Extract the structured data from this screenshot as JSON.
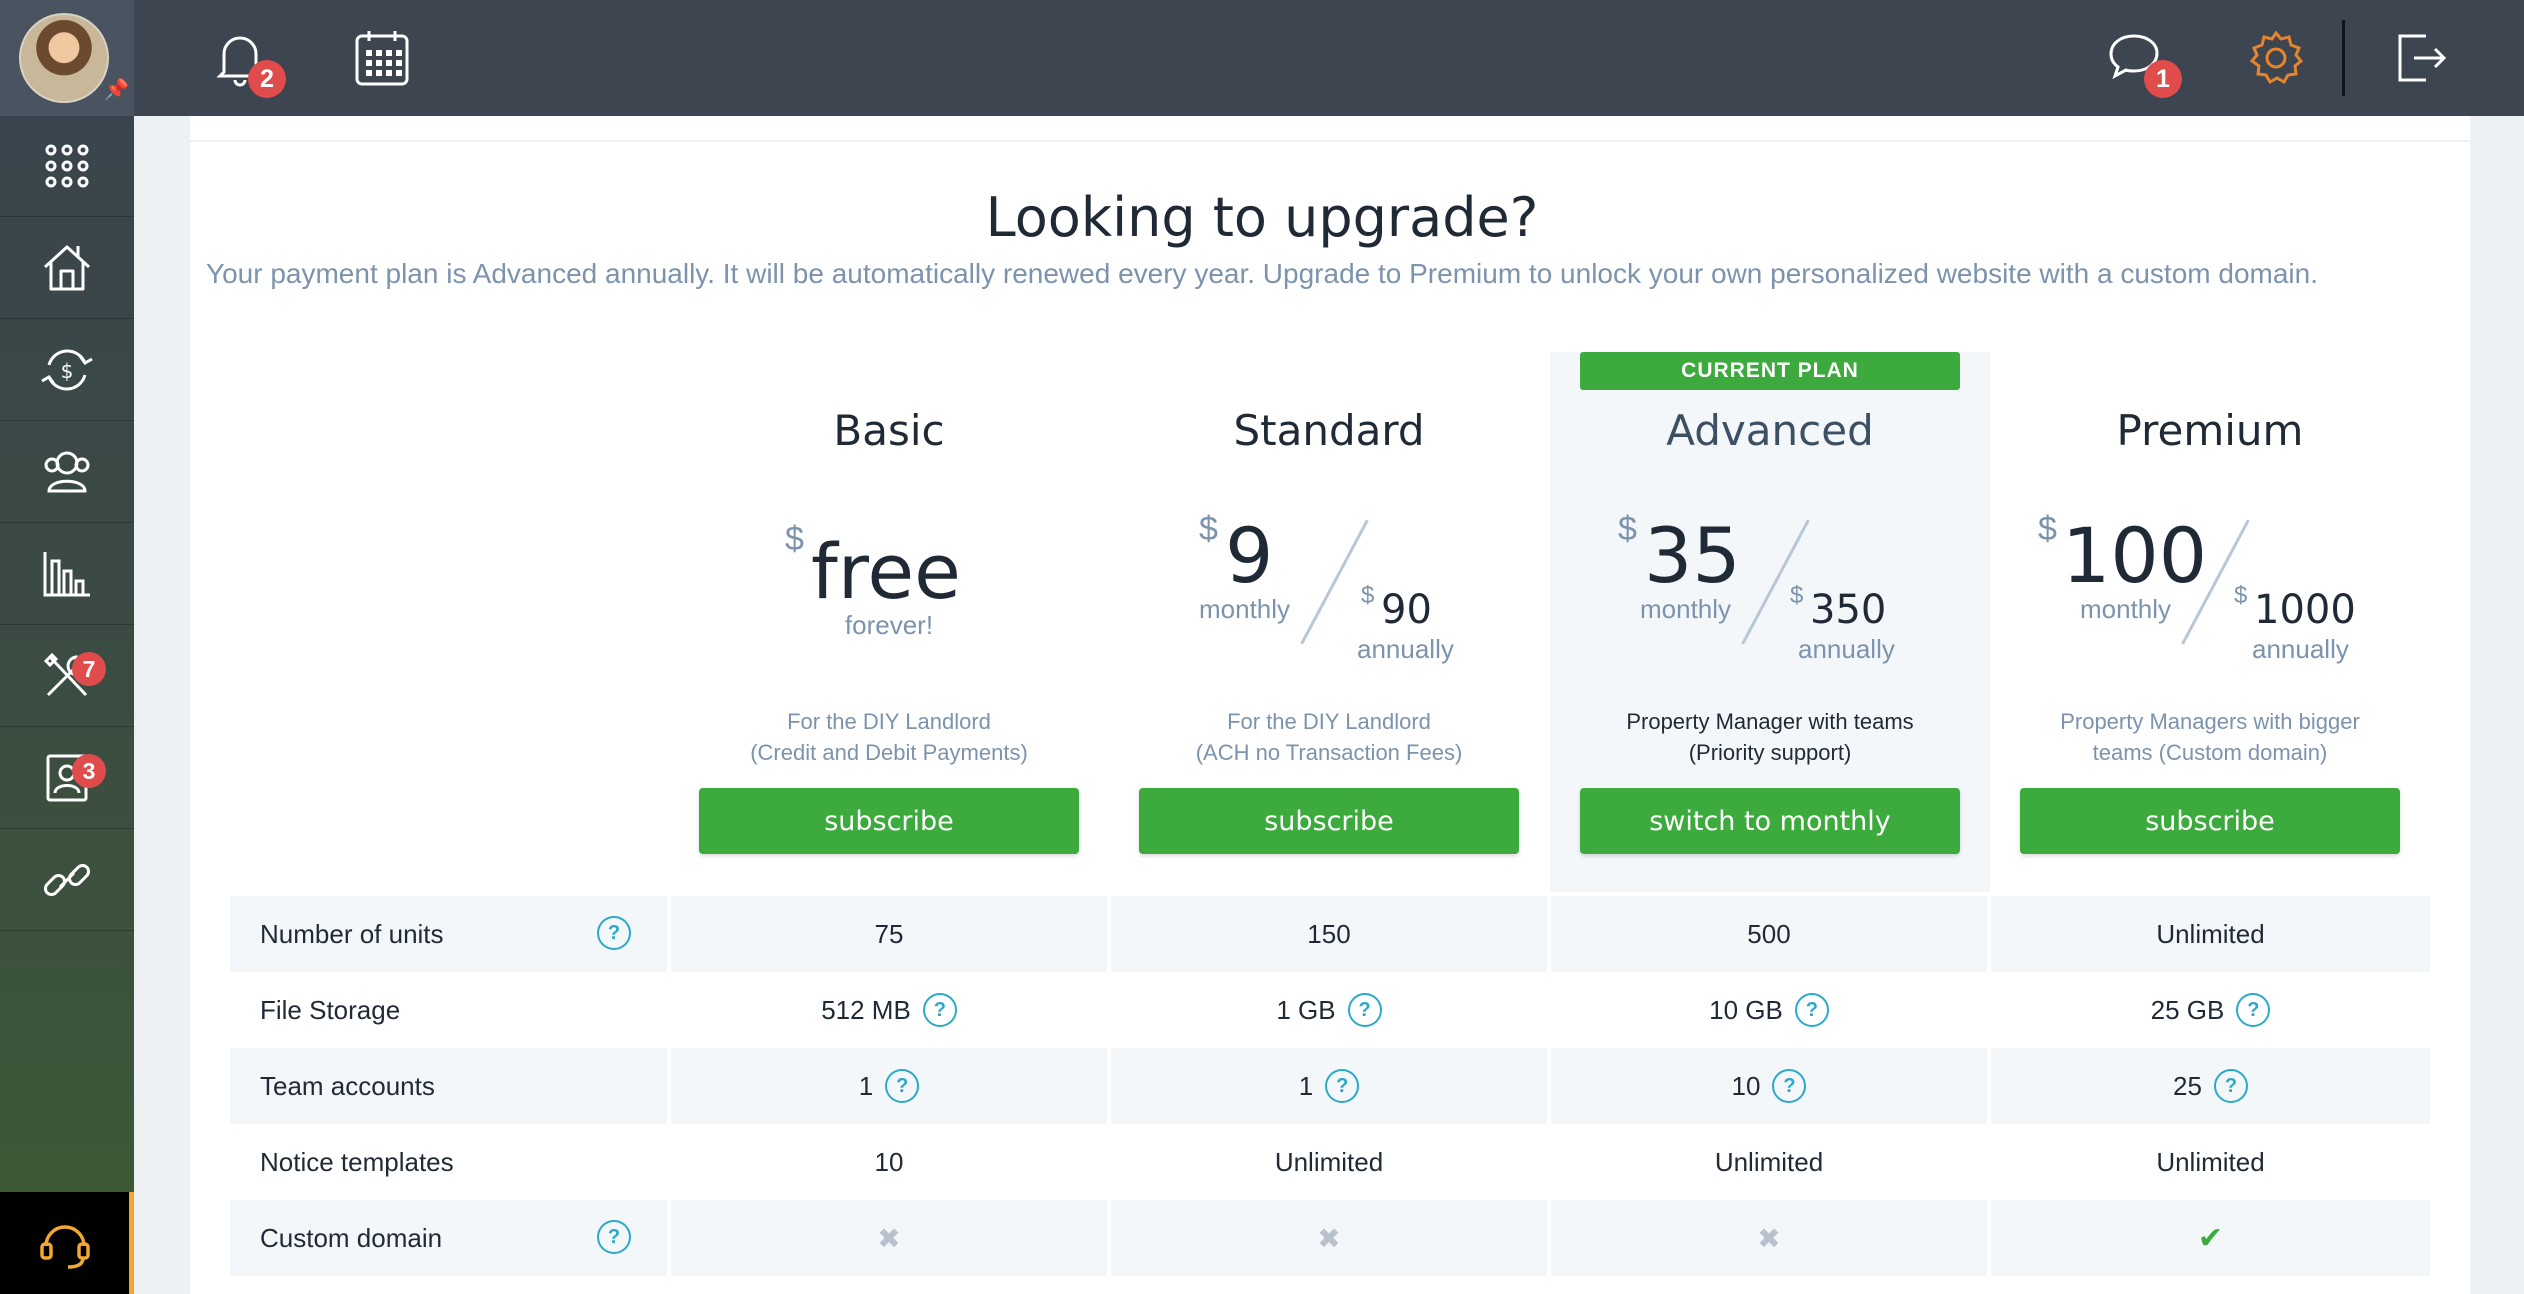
{
  "topbar": {
    "notifications_count": "2",
    "messages_count": "1"
  },
  "sidebar": {
    "badges": {
      "maintenance": "7",
      "tenants": "3"
    }
  },
  "main": {
    "title": "Looking to upgrade?",
    "subtitle": "Your payment plan is Advanced annually. It will be automatically renewed every year. Upgrade to Premium to unlock your own personalized website with a custom domain.",
    "current_plan_tag": "CURRENT PLAN",
    "plans": [
      {
        "name": "Basic",
        "currency": "$",
        "price": "free",
        "price_note": "forever!",
        "desc1": "For the DIY Landlord",
        "desc2": "(Credit and Debit Payments)",
        "button": "subscribe"
      },
      {
        "name": "Standard",
        "currency": "$",
        "monthly": "9",
        "monthly_label": "monthly",
        "annual": "90",
        "annual_label": "annually",
        "desc1": "For the DIY Landlord",
        "desc2": "(ACH no Transaction Fees)",
        "button": "subscribe"
      },
      {
        "name": "Advanced",
        "currency": "$",
        "monthly": "35",
        "monthly_label": "monthly",
        "annual": "350",
        "annual_label": "annually",
        "desc1": "Property Manager with teams",
        "desc2": "(Priority support)",
        "button": "switch to monthly"
      },
      {
        "name": "Premium",
        "currency": "$",
        "monthly": "100",
        "monthly_label": "monthly",
        "annual": "1000",
        "annual_label": "annually",
        "desc1": "Property Managers with bigger",
        "desc2": "teams (Custom domain)",
        "button": "subscribe"
      }
    ],
    "help_glyph": "?",
    "features": [
      {
        "label": "Number of units",
        "values": [
          "75",
          "150",
          "500",
          "Unlimited"
        ]
      },
      {
        "label": "File Storage",
        "values": [
          "512 MB",
          "1 GB",
          "10 GB",
          "25 GB"
        ]
      },
      {
        "label": "Team accounts",
        "values": [
          "1",
          "1",
          "10",
          "25"
        ]
      },
      {
        "label": "Notice templates",
        "values": [
          "10",
          "Unlimited",
          "Unlimited",
          "Unlimited"
        ]
      },
      {
        "label": "Custom domain",
        "values": [
          "✖",
          "✖",
          "✖",
          "✔"
        ]
      }
    ]
  }
}
